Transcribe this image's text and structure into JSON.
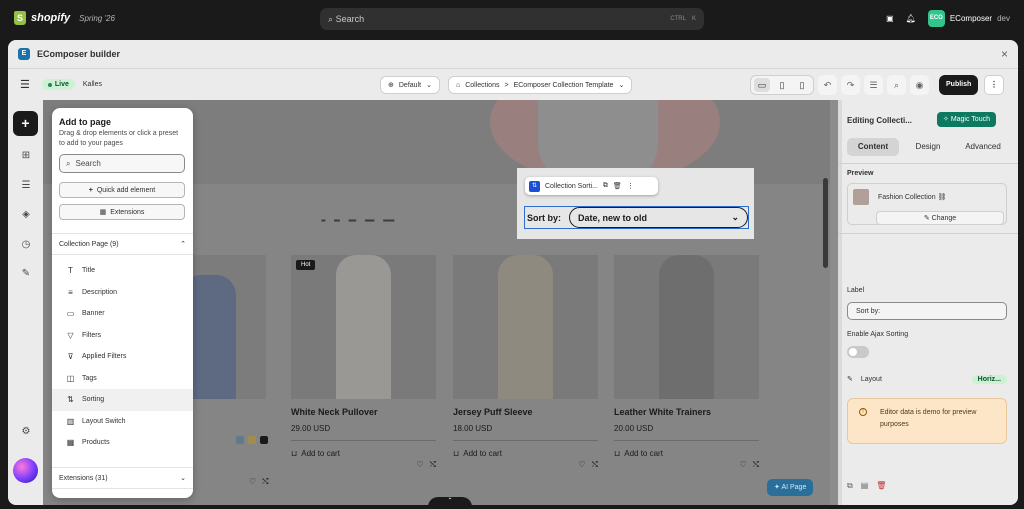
{
  "shopify": {
    "logo_text": "shopify",
    "edition": "Spring '26",
    "search_placeholder": "Search",
    "shortcut_ctrl": "CTRL",
    "shortcut_key": "K",
    "account_initials": "ECO",
    "account_name": "EComposer",
    "account_role": "dev"
  },
  "window": {
    "title": "EComposer builder",
    "close": "×"
  },
  "toolbar": {
    "live_label": "Live",
    "store_name": "Kalles",
    "language": "Default",
    "breadcrumb_parent": "Collections",
    "breadcrumb_sep": ">",
    "template_name": "EComposer Collection Template",
    "publish_label": "Publish"
  },
  "add_panel": {
    "title": "Add to page",
    "description": "Drag & drop elements or click a preset to add to your pages",
    "search_placeholder": "Search",
    "quick_add_label": "Quick add element",
    "extensions_label": "Extensions",
    "section_title": "Collection Page (9)",
    "items": [
      {
        "label": "Title",
        "icon": "title-icon",
        "glyph": "T"
      },
      {
        "label": "Description",
        "icon": "description-icon",
        "glyph": "≡"
      },
      {
        "label": "Banner",
        "icon": "banner-icon",
        "glyph": "▭"
      },
      {
        "label": "Filters",
        "icon": "filter-icon",
        "glyph": "▽"
      },
      {
        "label": "Applied Filters",
        "icon": "applied-filter-icon",
        "glyph": "⊽"
      },
      {
        "label": "Tags",
        "icon": "tag-icon",
        "glyph": "◫"
      },
      {
        "label": "Sorting",
        "icon": "sort-icon",
        "glyph": "⇅"
      },
      {
        "label": "Layout Switch",
        "icon": "layout-switch-icon",
        "glyph": "▥"
      },
      {
        "label": "Products",
        "icon": "products-icon",
        "glyph": "▦"
      }
    ],
    "extensions_section": "Extensions (31)"
  },
  "canvas": {
    "sort_element_name": "Collection Sorti...",
    "sort_label": "Sort by:",
    "sort_value": "Date, new to old",
    "ai_button": "AI Page",
    "products": [
      {
        "name": "",
        "price": "",
        "add": "",
        "badge": ""
      },
      {
        "name": "White Neck Pullover",
        "price": "29.00 USD",
        "add": "Add to cart",
        "badge": "Hot"
      },
      {
        "name": "Jersey Puff Sleeve",
        "price": "18.00 USD",
        "add": "Add to cart",
        "badge": ""
      },
      {
        "name": "Leather White Trainers",
        "price": "20.00 USD",
        "add": "Add to cart",
        "badge": ""
      }
    ]
  },
  "settings": {
    "title": "Editing Collecti...",
    "magic_label": "Magic Touch",
    "tabs": [
      "Content",
      "Design",
      "Advanced"
    ],
    "preview_label": "Preview",
    "preview_name": "Fashion Collection",
    "change_label": "Change",
    "label_label": "Label",
    "label_value": "Sort by:",
    "ajax_label": "Enable Ajax Sorting",
    "layout_label": "Layout",
    "layout_value": "Horiz...",
    "notice": "Editor data is demo for preview purposes"
  },
  "colors": {
    "accent_live": "#cdf1d4",
    "publish": "#1a1a1a",
    "magic_touch": "#0d7a5f",
    "selection": "#2c6ecb"
  }
}
